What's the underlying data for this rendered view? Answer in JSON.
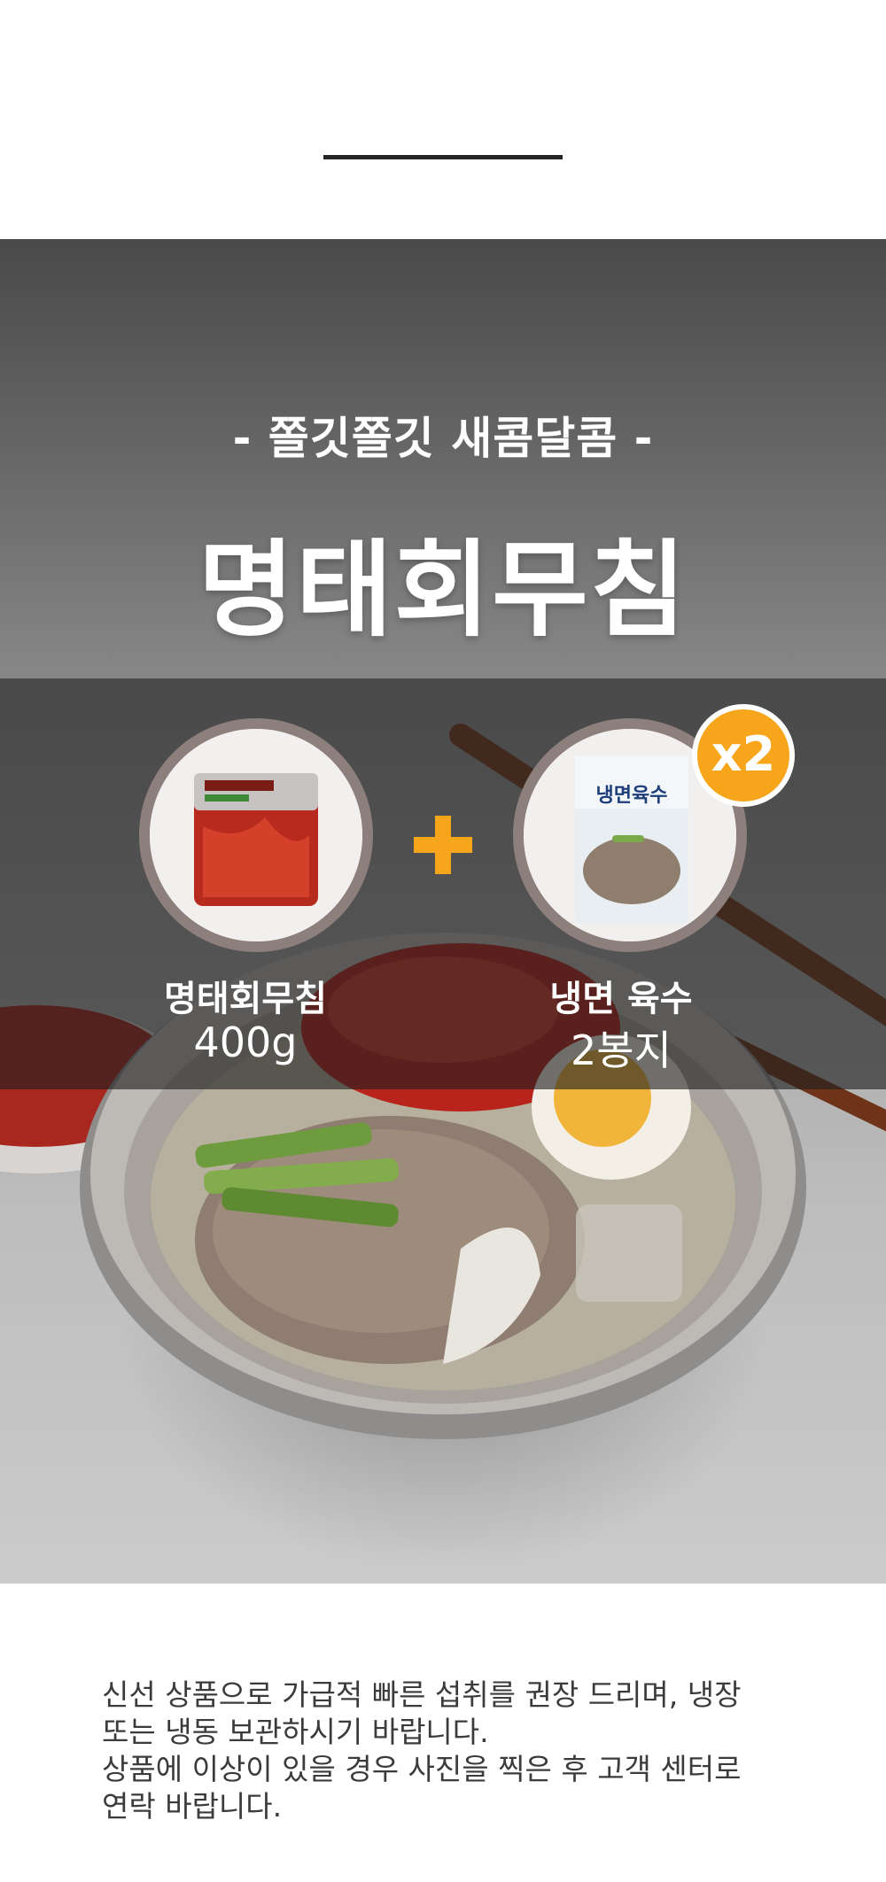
{
  "header": {
    "subtitle": "- 쫄깃쫄깃 새콤달콤 -",
    "title": "명태회무침"
  },
  "combo": {
    "item1": {
      "name": "명태회무침",
      "amount": "400g",
      "image_label": "명태회무침"
    },
    "plus_icon": "plus-icon",
    "item2": {
      "name": "냉면 육수",
      "amount": "2봉지",
      "image_label": "동치미 냉면육수"
    },
    "badge": "x2"
  },
  "notice": {
    "line1": "신선 상품으로 가급적 빠른 섭취를 권장 드리며, 냉장 또는 냉동 보관하시기 바랍니다.",
    "line2": "상품에 이상이 있을 경우 사진을 찍은 후 고객 센터로 연락 바랍니다."
  },
  "colors": {
    "accent": "#f7a51b",
    "circle_border": "#8d7f7c",
    "text_dark": "#3b3b3b"
  }
}
